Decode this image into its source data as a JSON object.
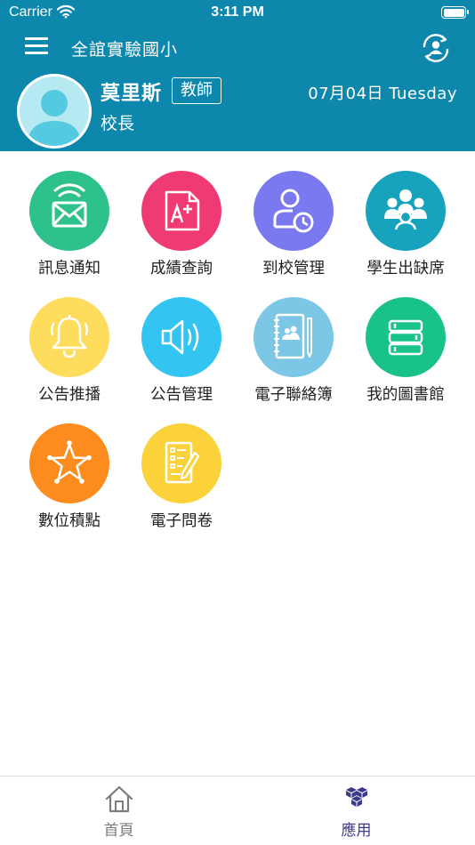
{
  "status_bar": {
    "carrier": "Carrier",
    "time": "3:11 PM"
  },
  "header": {
    "school_name": "全誼實驗國小",
    "user_name": "莫里斯",
    "role_badge": "教師",
    "title": "校長",
    "date": "07月04日 Tuesday",
    "colors": {
      "background": "#0e87ac"
    }
  },
  "apps": [
    {
      "label": "訊息通知",
      "icon": "message-notification-icon",
      "color": "#2fc18c"
    },
    {
      "label": "成績查詢",
      "icon": "grade-query-icon",
      "color": "#f03a73"
    },
    {
      "label": "到校管理",
      "icon": "attendance-clock-icon",
      "color": "#7b79ef"
    },
    {
      "label": "學生出缺席",
      "icon": "student-group-icon",
      "color": "#17a2bd"
    },
    {
      "label": "公告推播",
      "icon": "bell-icon",
      "color": "#fddc5e"
    },
    {
      "label": "公告管理",
      "icon": "speaker-icon",
      "color": "#33c4f2"
    },
    {
      "label": "電子聯絡簿",
      "icon": "contact-book-icon",
      "color": "#7cc6e6"
    },
    {
      "label": "我的圖書館",
      "icon": "books-icon",
      "color": "#19c387"
    },
    {
      "label": "數位積點",
      "icon": "star-badge-icon",
      "color": "#fe8b1d"
    },
    {
      "label": "電子問卷",
      "icon": "questionnaire-icon",
      "color": "#fcd23a"
    }
  ],
  "tab_bar": {
    "tabs": [
      {
        "label": "首頁",
        "icon": "home-icon",
        "active": false
      },
      {
        "label": "應用",
        "icon": "apps-cubes-icon",
        "active": true
      }
    ],
    "colors": {
      "active": "#3c3a8a",
      "inactive": "#7d7d7d"
    }
  }
}
